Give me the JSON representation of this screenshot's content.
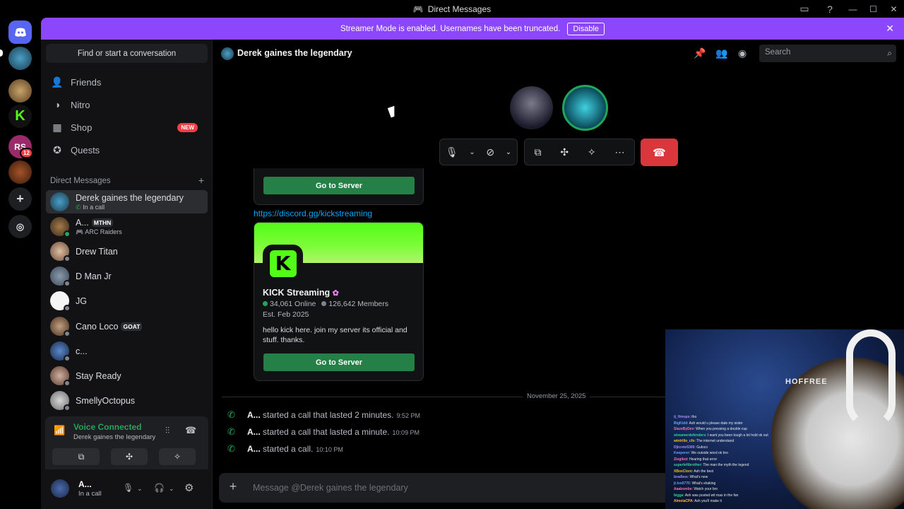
{
  "window": {
    "title": "Direct Messages"
  },
  "banner": {
    "text": "Streamer Mode is enabled. Usernames have been truncated.",
    "button": "Disable"
  },
  "rail": {
    "badge_count": "12",
    "server_initials": "RS"
  },
  "sidebar": {
    "find_placeholder": "Find or start a conversation",
    "nav": [
      {
        "label": "Friends",
        "icon": "friends-icon"
      },
      {
        "label": "Nitro",
        "icon": "nitro-icon"
      },
      {
        "label": "Shop",
        "icon": "shop-icon",
        "badge": "NEW"
      },
      {
        "label": "Quests",
        "icon": "quests-icon"
      }
    ],
    "dm_header": "Direct Messages",
    "dms": [
      {
        "name": "Derek gaines the legendary",
        "sub": "In a call",
        "active": true
      },
      {
        "name": "A...",
        "tag": "MTHN",
        "sub": "ARC Raiders"
      },
      {
        "name": "Drew Titan"
      },
      {
        "name": "D Man Jr"
      },
      {
        "name": "JG"
      },
      {
        "name": "Cano Loco",
        "tag": "GOAT"
      },
      {
        "name": "c..."
      },
      {
        "name": "Stay Ready"
      },
      {
        "name": "SmellyOctopus"
      }
    ]
  },
  "voice": {
    "title": "Voice Connected",
    "channel": "Derek gaines the legendary"
  },
  "user": {
    "name": "A...",
    "status": "In a call"
  },
  "channel": {
    "name": "Derek gaines the legendary",
    "search_placeholder": "Search"
  },
  "messages": {
    "goto_label": "Go to Server",
    "invite_link": "https://discord.gg/kickstreaming",
    "invite": {
      "name": "KICK Streaming",
      "online": "34,061 Online",
      "members": "126,642 Members",
      "est": "Est. Feb 2025",
      "description": "hello kick here. join my server its official and stuff. thanks."
    },
    "date_divider": "November 25, 2025",
    "calls": [
      {
        "who": "A...",
        "text": "started a call that lasted 2 minutes.",
        "time": "9:52 PM"
      },
      {
        "who": "A...",
        "text": "started a call that lasted a minute.",
        "time": "10:09 PM"
      },
      {
        "who": "A...",
        "text": "started a call.",
        "time": "10:10 PM"
      }
    ]
  },
  "composer": {
    "placeholder": "Message @Derek gaines the legendary"
  },
  "webcam": {
    "cap_text": "HOFFREE",
    "chat": [
      {
        "user": "tj_ftmops",
        "msg": "tho"
      },
      {
        "user": "BigKidd",
        "msg": "Ash would u please date my sister"
      },
      {
        "user": "SlazeByDev",
        "msg": "When you pressing a double cup"
      },
      {
        "user": "streamerdefenders",
        "msg": "I want you been tough a lot hold ok out"
      },
      {
        "user": "wintrillo_cfo",
        "msg": "The internet understand"
      },
      {
        "user": "Djlcrete5300",
        "msg": "Guloco"
      },
      {
        "user": "Keeperer",
        "msg": "We outside word ok bro"
      },
      {
        "user": "Ziegiboi",
        "msg": "Hearing that error"
      },
      {
        "user": "superleftbrother",
        "msg": "The man the myth the legend"
      },
      {
        "user": "XBoxCloro",
        "msg": "Ash the best"
      },
      {
        "user": "bradbus",
        "msg": "What's new"
      },
      {
        "user": "jt.tvs0770",
        "msg": "What's shaking"
      },
      {
        "user": "Aaabombs",
        "msg": "Watch your bro"
      },
      {
        "user": "bigga",
        "msg": "Ash was posted wit max in the fan"
      },
      {
        "user": "AlmelaCPA",
        "msg": "Ash you'll make it"
      }
    ]
  },
  "colors": {
    "accent": "#8c47fc",
    "online": "#23a55a",
    "danger": "#da373c",
    "link": "#00a8fc",
    "kick": "#53fc18"
  }
}
